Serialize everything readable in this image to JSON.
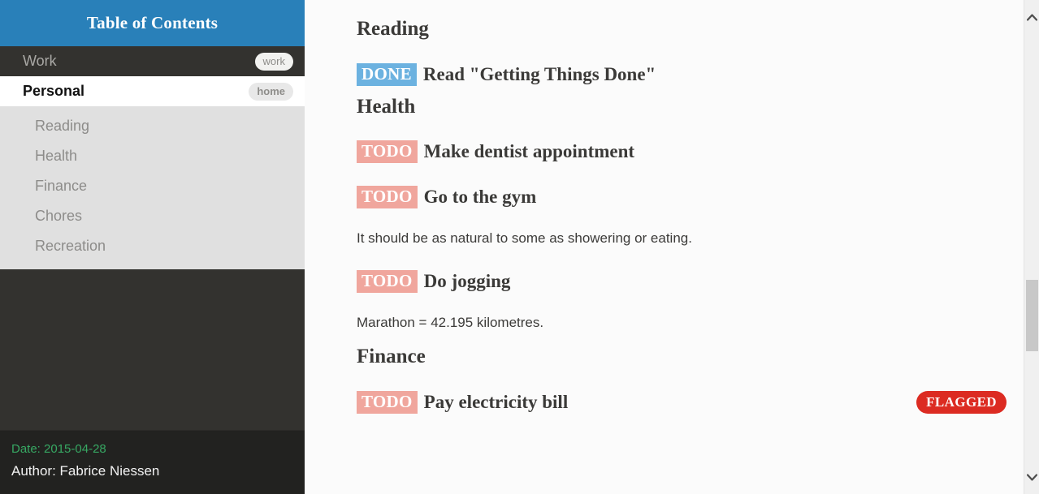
{
  "sidebar": {
    "header_title": "Table of Contents",
    "top_items": [
      {
        "label": "Work",
        "tag": "work",
        "active": false
      },
      {
        "label": "Personal",
        "tag": "home",
        "active": true
      }
    ],
    "sub_items": [
      {
        "label": "Reading"
      },
      {
        "label": "Health"
      },
      {
        "label": "Finance"
      },
      {
        "label": "Chores"
      },
      {
        "label": "Recreation"
      }
    ],
    "footer": {
      "date": "Date: 2015-04-28",
      "author": "Author: Fabrice Niessen"
    }
  },
  "content": {
    "sections": [
      {
        "heading": "Reading",
        "tasks": [
          {
            "keyword": "DONE",
            "title": "Read \"Getting Things Done\"",
            "flag": null
          }
        ],
        "paragraphs": []
      },
      {
        "heading": "Health",
        "tasks": [
          {
            "keyword": "TODO",
            "title": "Make dentist appointment",
            "flag": null
          },
          {
            "keyword": "TODO",
            "title": "Go to the gym",
            "flag": null
          }
        ],
        "notes": [
          "It should be as natural to some as showering or eating.",
          "Marathon = 42.195 kilometres."
        ]
      },
      {
        "heading": "Finance",
        "tasks": [
          {
            "keyword": "TODO",
            "title": "Pay electricity bill",
            "flag": "FLAGGED"
          }
        ]
      }
    ],
    "flow": [
      {
        "kind": "heading",
        "text": "Reading"
      },
      {
        "kind": "task",
        "keyword": "DONE",
        "title": "Read \"Getting Things Done\"",
        "flag": null
      },
      {
        "kind": "heading",
        "text": "Health"
      },
      {
        "kind": "task",
        "keyword": "TODO",
        "title": "Make dentist appointment",
        "flag": null
      },
      {
        "kind": "task",
        "keyword": "TODO",
        "title": "Go to the gym",
        "flag": null
      },
      {
        "kind": "para",
        "text": "It should be as natural to some as showering or eating."
      },
      {
        "kind": "task",
        "keyword": "TODO",
        "title": "Do jogging",
        "flag": null
      },
      {
        "kind": "para",
        "text": "Marathon = 42.195 kilometres."
      },
      {
        "kind": "heading",
        "text": "Finance"
      },
      {
        "kind": "task",
        "keyword": "TODO",
        "title": "Pay electricity bill",
        "flag": "FLAGGED"
      }
    ]
  },
  "scrollbar": {
    "up_arrow_glyph": "∧",
    "down_arrow_glyph": "∨"
  },
  "colors": {
    "header_blue": "#2980b9",
    "sidebar_dark": "#33322f",
    "sidebar_sub_gray": "#e0e0e0",
    "footer_dark": "#222220",
    "done_badge": "#6cb2e0",
    "todo_badge": "#f0a69d",
    "flagged_badge": "#dc2b22",
    "date_green": "#37a863",
    "content_bg": "#fbfbfb"
  }
}
